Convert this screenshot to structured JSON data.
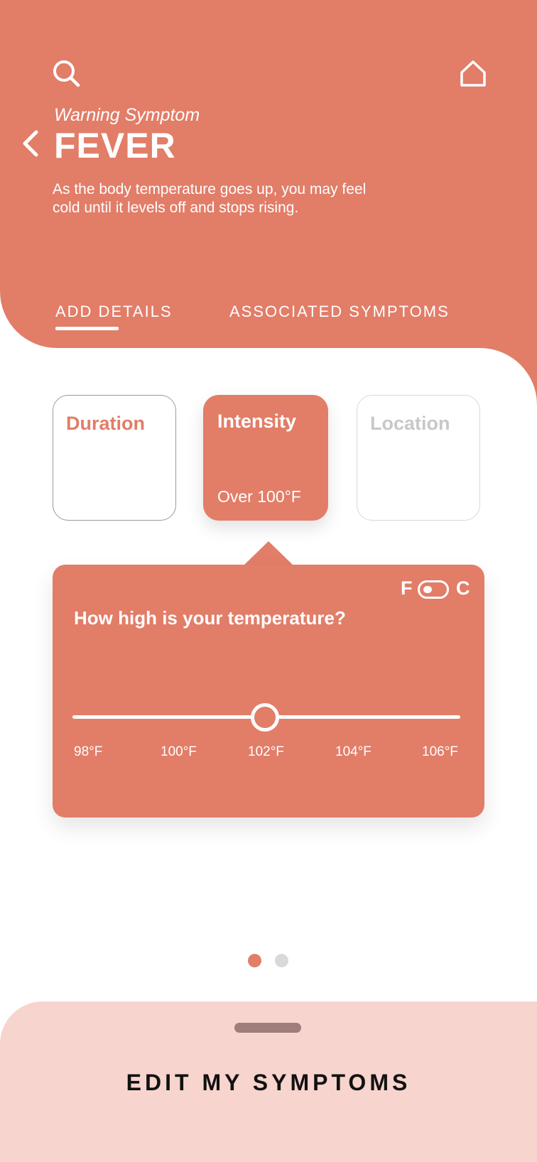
{
  "colors": {
    "accent": "#e27d68",
    "sheet": "#f7d4cd",
    "muted": "#c8c8c8"
  },
  "header": {
    "subtitle": "Warning Symptom",
    "title": "FEVER",
    "description": "As the body temperature goes up, you may feel cold until it levels off and stops rising.",
    "icons": {
      "search": "search-icon",
      "home": "home-icon",
      "back": "chevron-left-icon"
    },
    "tabs": [
      {
        "label": "ADD DETAILS",
        "active": true
      },
      {
        "label": "ASSOCIATED SYMPTOMS",
        "active": false
      }
    ]
  },
  "cards": [
    {
      "title": "Duration",
      "value": ""
    },
    {
      "title": "Intensity",
      "value": "Over 100°F",
      "selected": true
    },
    {
      "title": "Location",
      "value": "",
      "disabled": true
    }
  ],
  "temperature": {
    "question": "How high is your temperature?",
    "unit_f": "F",
    "unit_c": "C",
    "ticks": [
      "98°F",
      "100°F",
      "102°F",
      "104°F",
      "106°F"
    ],
    "value_label": "102°F"
  },
  "pagination": {
    "current": 1,
    "total": 2
  },
  "sheet": {
    "label": "EDIT MY SYMPTOMS"
  }
}
